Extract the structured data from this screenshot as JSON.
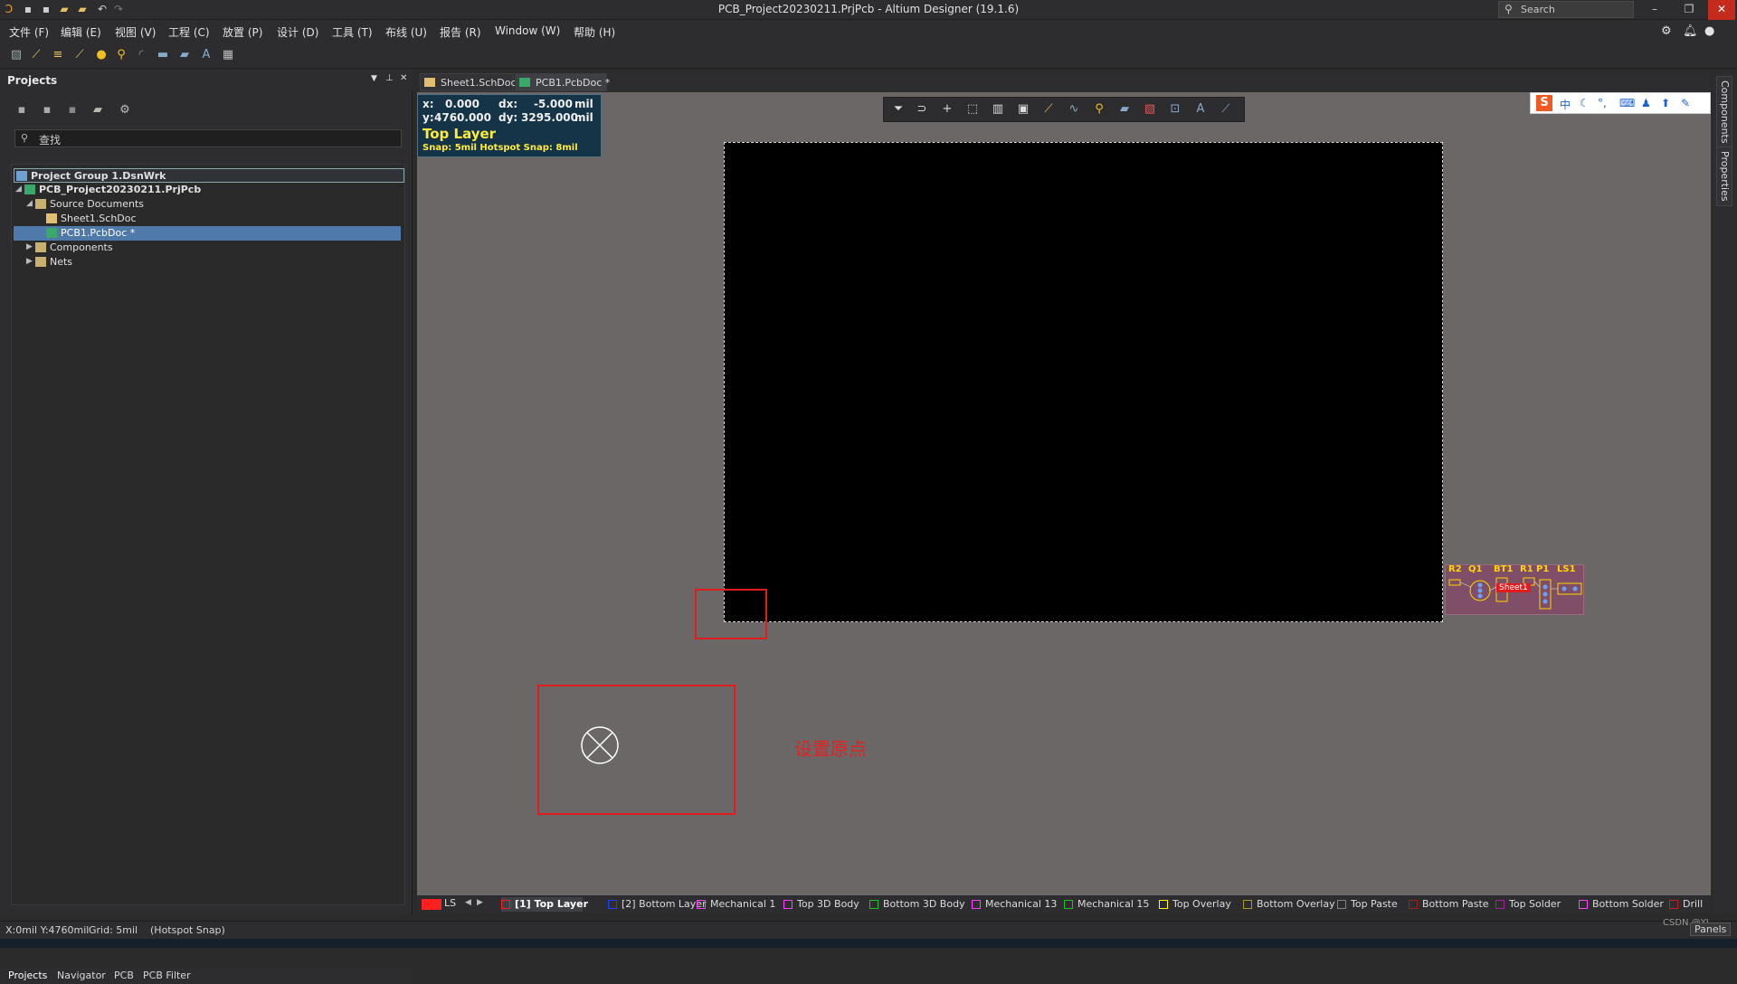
{
  "window": {
    "title": "PCB_Project20230211.PrjPcb - Altium Designer (19.1.6)"
  },
  "search": {
    "placeholder": "Search"
  },
  "menu": [
    "文件 (F)",
    "编辑 (E)",
    "视图 (V)",
    "工程 (C)",
    "放置 (P)",
    "设计 (D)",
    "工具 (T)",
    "布线 (U)",
    "报告 (R)",
    "Window (W)",
    "帮助 (H)"
  ],
  "projects_panel": {
    "title": "Projects",
    "search_placeholder": "查找",
    "tree": [
      {
        "label": "Project Group 1.DsnWrk",
        "icon": "project-group-icon"
      },
      {
        "label": "PCB_Project20230211.PrjPcb",
        "icon": "pcb-project-icon"
      },
      {
        "label": "Source Documents",
        "icon": "folder-icon"
      },
      {
        "label": "Sheet1.SchDoc",
        "icon": "schematic-doc-icon"
      },
      {
        "label": "PCB1.PcbDoc *",
        "icon": "pcb-doc-icon"
      },
      {
        "label": "Components",
        "icon": "folder-icon"
      },
      {
        "label": "Nets",
        "icon": "folder-icon"
      }
    ],
    "bottom_tabs": [
      "Projects",
      "Navigator",
      "PCB",
      "PCB Filter"
    ]
  },
  "doc_tabs": [
    {
      "label": "Sheet1.SchDoc"
    },
    {
      "label": "PCB1.PcbDoc *"
    }
  ],
  "hud": {
    "x_label": "x:",
    "x_value": "0.000",
    "dx_label": "dx:",
    "dx_value": "-5.000",
    "unit": "mil",
    "y_label": "y:",
    "y_value": "4760.000",
    "dy_label": "dy:",
    "dy_value": "3295.000",
    "layer": "Top Layer",
    "snap": "Snap: 5mil Hotspot Snap: 8mil"
  },
  "components": {
    "labels": [
      "R2",
      "Q1",
      "BT1",
      "R1",
      "P1",
      "LS1"
    ],
    "room_label": "Sheet1"
  },
  "annotation": {
    "text": "设置原点"
  },
  "right_panels": [
    "Components",
    "Properties"
  ],
  "layer_bar": {
    "ls_label": "LS",
    "layers": [
      {
        "name": "[1] Top Layer",
        "color": "#ff2020"
      },
      {
        "name": "[2] Bottom Layer",
        "color": "#2040ff"
      },
      {
        "name": "Mechanical 1",
        "color": "#ff40ff"
      },
      {
        "name": "Top 3D Body",
        "color": "#ff40ff"
      },
      {
        "name": "Bottom 3D Body",
        "color": "#20c020"
      },
      {
        "name": "Mechanical 13",
        "color": "#ff40ff"
      },
      {
        "name": "Mechanical 15",
        "color": "#20c020"
      },
      {
        "name": "Top Overlay",
        "color": "#ffff00"
      },
      {
        "name": "Bottom Overlay",
        "color": "#a0a020"
      },
      {
        "name": "Top Paste",
        "color": "#808080"
      },
      {
        "name": "Bottom Paste",
        "color": "#a02020"
      },
      {
        "name": "Top Solder",
        "color": "#a020a0"
      },
      {
        "name": "Bottom Solder",
        "color": "#ff40ff"
      },
      {
        "name": "Drill",
        "color": "#c02020"
      }
    ]
  },
  "status": {
    "coords": "X:0mil Y:4760mil",
    "grid": "Grid: 5mil",
    "snap": "(Hotspot Snap)",
    "panels_button": "Panels",
    "watermark": "CSDN @YL..."
  }
}
